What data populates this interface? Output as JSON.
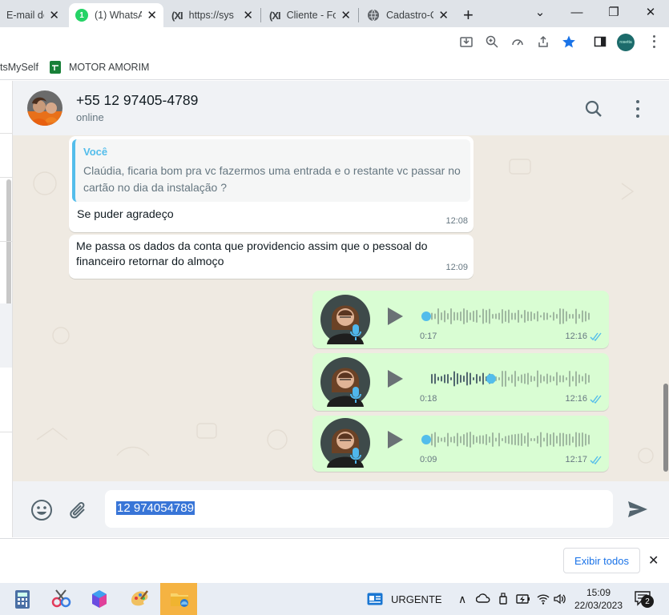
{
  "browser": {
    "tabs": [
      {
        "label": "E-mail de C",
        "active": false
      },
      {
        "label": "(1) WhatsA",
        "active": true,
        "badge": "1"
      },
      {
        "label": "https://sys",
        "active": false
      },
      {
        "label": "Cliente - Fo",
        "active": false
      },
      {
        "label": "Cadastro-C",
        "active": false
      }
    ],
    "profile_label": "rosetta"
  },
  "bookmarks": [
    {
      "label": "tsMySelf"
    },
    {
      "label": "MOTOR AMORIM"
    }
  ],
  "chat": {
    "contact_name": "+55 12 97405-4789",
    "status": "online",
    "messages": [
      {
        "type": "reply",
        "quoted_author": "Você",
        "quoted_text": "Claúdia, ficaria bom pra vc fazermos uma entrada e o restante vc passar no cartão no dia da instalação ?",
        "text": "Se puder agradeço",
        "time": "12:08"
      },
      {
        "type": "text",
        "text": "Me passa os dados da conta que providencio assim que o pessoal do financeiro retornar do almoço",
        "time": "12:09"
      },
      {
        "type": "audio",
        "duration": "0:17",
        "time": "12:16",
        "progress": 0
      },
      {
        "type": "audio",
        "duration": "0:18",
        "time": "12:16",
        "progress": 0.4
      },
      {
        "type": "audio",
        "duration": "0:09",
        "time": "12:17",
        "progress": 0
      }
    ],
    "input_value": "12 974054789"
  },
  "notification": {
    "show_all_label": "Exibir todos"
  },
  "taskbar": {
    "urgent_label": "URGENTE",
    "time": "15:09",
    "date": "22/03/2023",
    "notification_count": "2"
  },
  "colors": {
    "accent": "#53bdeb",
    "outgoing_bubble": "#d9fdd3",
    "chat_bg": "#efeae2",
    "quote_bar": "#53bdeb",
    "quote_author": "#06cf9c"
  }
}
